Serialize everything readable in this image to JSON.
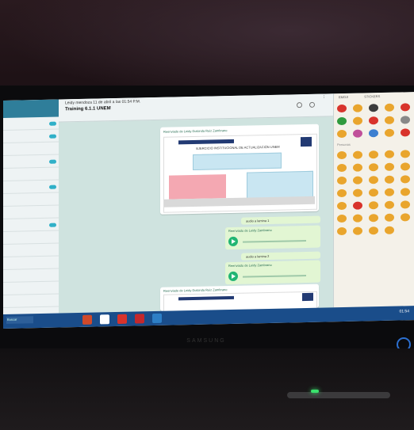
{
  "conversation": {
    "title_line": "Leidy mendoza 11 de abril a las 01:54 P.M.",
    "name": "Training 6.1.1 UNEM",
    "status": ""
  },
  "messages": {
    "doc_caption": "Reenviado de Leidy Dolcinda Ruiz Zambrano",
    "doc_heading": "EJERCICIO INSTITUCIONAL DE ACTUALIZACIÓN UNEM",
    "audio1": "audio a lamina 1",
    "audio2": "audio a lamina 2",
    "forwarded1": "Reenviado de Leidy Zambrano",
    "forwarded2": "Reenviado de Leidy Zambrano",
    "doc2_caption": "Reenviado de Leidy Dolcinda Ruiz Zambrano"
  },
  "emoji_panel": {
    "tab_left": "EMOJI",
    "tab_right": "STICKERS",
    "section": "Personas"
  },
  "taskbar": {
    "search": "Buscar",
    "clock": "01:54"
  },
  "monitor": {
    "brand": "SAMSUNG"
  },
  "colors": {
    "accent": "#2f7e9a",
    "chat_bg": "#cfe3df",
    "bubble_out": "#e2f6d3",
    "play": "#21b573",
    "taskbar": "#1a4d8a"
  }
}
